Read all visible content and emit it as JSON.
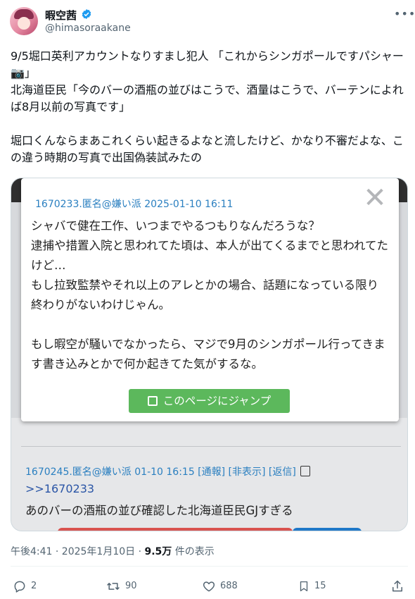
{
  "author": {
    "display_name": "暇空茜",
    "handle": "@himasoraakane"
  },
  "tweet": {
    "text": "9/5堀口英利アカウントなりすまし犯人 「これからシンガポールですパシャー📷」\n北海道臣民「今のバーの酒瓶の並びはこうで、酒量はこうで、バーテンによれば8月以前の写真です」\n\n堀口くんならまあこれくらい起きるよなと流したけど、かなり不審だよな、この違う時期の写真で出国偽装試みたの"
  },
  "image": {
    "popup": {
      "header": "1670233.匿名@嫌い派 2025-01-10 16:11",
      "close_symbol": "✕",
      "body": "シャバで健在工作、いつまでやるつもりなんだろうな？\n逮捕や措置入院と思われてた頃は、本人が出てくるまでと思われてたけど…\nもし拉致監禁やそれ以上のアレとかの場合、話題になっている限り終わりがないわけじゃん。\n\nもし暇空が騒いでなかったら、マジで9月のシンガポール行ってきます書き込みとかで何か起きてた気がするな。",
      "jump_button": "このページにジャンプ"
    },
    "reply": {
      "header": "1670245.匿名@嫌い派 01-10 16:15 [通報] [非表示] [返信]",
      "anchor": ">>1670233",
      "text": "あのバーの酒瓶の並び確認した北海道臣民GJすぎる"
    }
  },
  "meta": {
    "time": "午後4:41 · 2025年1月10日 · ",
    "views_count": "9.5万",
    "views_label": " 件の表示"
  },
  "actions": {
    "replies": "2",
    "reposts": "90",
    "likes": "688",
    "bookmarks": "15"
  },
  "colors": {
    "verified": "#1d9bf0",
    "link_blue": "#2a7fc0",
    "jump_green": "#5cb85c"
  }
}
